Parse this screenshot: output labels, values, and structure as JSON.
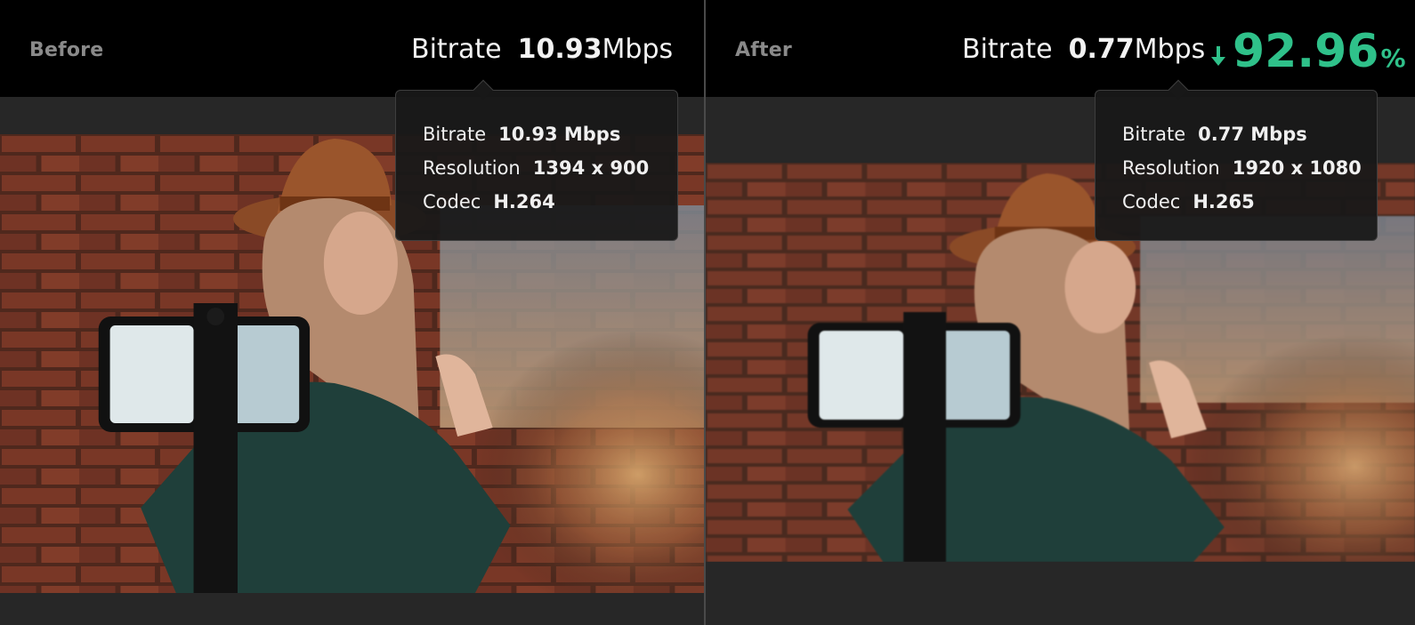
{
  "before": {
    "label": "Before",
    "headline": {
      "label": "Bitrate",
      "value": "10.93",
      "unit": "Mbps"
    },
    "tooltip": {
      "bitrate": {
        "label": "Bitrate",
        "value": "10.93 Mbps"
      },
      "resolution": {
        "label": "Resolution",
        "value": "1394 x 900"
      },
      "codec": {
        "label": "Codec",
        "value": "H.264"
      }
    }
  },
  "after": {
    "label": "After",
    "headline": {
      "label": "Bitrate",
      "value": "0.77",
      "unit": "Mbps"
    },
    "reduction": {
      "value": "92.96",
      "sign": "%"
    },
    "tooltip": {
      "bitrate": {
        "label": "Bitrate",
        "value": "0.77 Mbps"
      },
      "resolution": {
        "label": "Resolution",
        "value": "1920 x 1080"
      },
      "codec": {
        "label": "Codec",
        "value": "H.265"
      }
    }
  },
  "colors": {
    "reduction": "#2fc18a",
    "topbar": "#000000",
    "panel": "#272727"
  },
  "icons": {
    "reduction": "down-arrow-icon"
  }
}
